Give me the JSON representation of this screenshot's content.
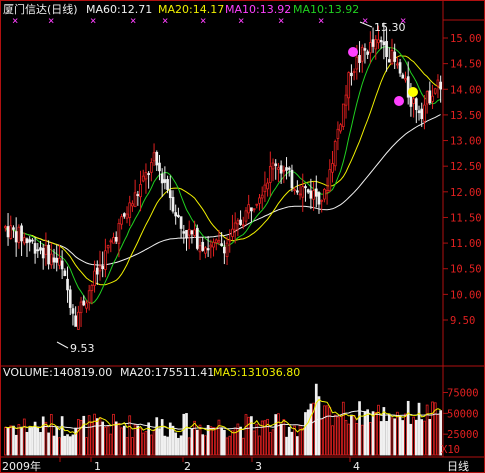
{
  "header": {
    "stock_name": "厦门信达(日线)",
    "ma60": "MA60:12.71",
    "ma20": "MA20:14.17",
    "ma10a": "MA10:13.92",
    "ma10b": "MA10:13.92"
  },
  "volume_header": {
    "volume": "VOLUME:140819.00",
    "ma20": "MA20:175511.41",
    "ma5": "MA5:131036.80"
  },
  "annotations": {
    "high_label": "15.30",
    "low_label": "9.53"
  },
  "bottom_bar": {
    "year_label": "2009年",
    "months": [
      "1",
      "2",
      "3",
      "4"
    ],
    "period": "日线"
  },
  "colors": {
    "background": "#000000",
    "frame": "#b01010",
    "up_candle": "#e02020",
    "down_candle": "#f0f0f0",
    "ma_white": "#f0f0f0",
    "ma_yellow": "#f0f000",
    "ma_green": "#20d020",
    "markers": "#ff40ff",
    "dot_yellow": "#ffff00",
    "dot_magenta": "#ff40ff"
  },
  "chart_data": [
    {
      "type": "candlestick",
      "title": "厦门信达(日线)",
      "ylim": [
        9.3,
        15.5
      ],
      "y_ticks": [
        "15.00",
        "14.50",
        "14.00",
        "13.50",
        "13.00",
        "12.50",
        "12.00",
        "11.50",
        "11.00",
        "10.50",
        "10.00",
        "9.50"
      ],
      "annotations": [
        {
          "text": "15.30",
          "value": 15.3
        },
        {
          "text": "9.53",
          "value": 9.53
        }
      ],
      "series": [
        {
          "name": "MA60",
          "value_label": "12.71"
        },
        {
          "name": "MA20",
          "value_label": "14.17"
        },
        {
          "name": "MA10",
          "value_label": "13.92"
        }
      ]
    },
    {
      "type": "bar",
      "title": "VOLUME",
      "ylim": [
        0,
        90000
      ],
      "y_ticks": [
        "75000",
        "50000",
        "25000"
      ],
      "unit_label": "X10",
      "series": [
        {
          "name": "VOLUME",
          "value_label": "140819.00"
        },
        {
          "name": "MA20",
          "value_label": "175511.41"
        },
        {
          "name": "MA5",
          "value_label": "131036.80"
        }
      ]
    }
  ]
}
